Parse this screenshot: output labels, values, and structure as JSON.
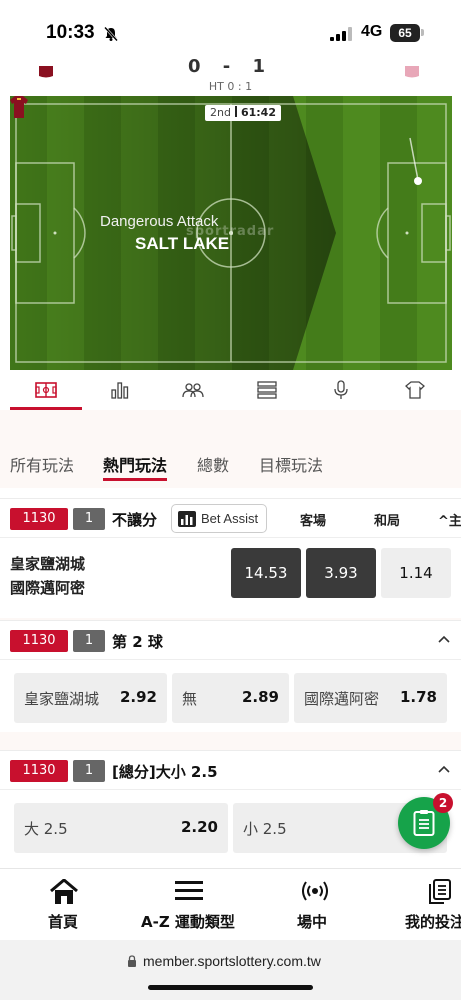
{
  "status_bar": {
    "time": "10:33",
    "network": "4G",
    "battery": "65"
  },
  "score_header": {
    "score": "0 - 1",
    "half_time": "HT 0 : 1"
  },
  "match_tracker": {
    "period": "2nd",
    "clock": "61:42",
    "event": "Dangerous Attack",
    "team": "SALT LAKE",
    "watermark": "sportradar"
  },
  "icon_tabs": [
    "pitch-icon",
    "stats-icon",
    "lineup-icon",
    "list-icon",
    "commentary-icon",
    "kit-icon"
  ],
  "category_tabs": [
    "所有玩法",
    "熱門玩法",
    "總數",
    "目標玩法"
  ],
  "active_category": "熱門玩法",
  "markets": {
    "m1": {
      "code": "1130",
      "num": "1",
      "title": "不讓分",
      "bet_assist": "Bet Assist",
      "headers": {
        "away": "客場",
        "draw": "和局",
        "home": "主"
      },
      "home_team": "皇家鹽湖城",
      "away_team": "國際邁阿密",
      "odds": {
        "away": "14.53",
        "draw": "3.93",
        "home": "1.14"
      }
    },
    "m2": {
      "code": "1130",
      "num": "1",
      "title": "第 2 球",
      "options": [
        {
          "label": "皇家鹽湖城",
          "odd": "2.92"
        },
        {
          "label": "無",
          "odd": "2.89"
        },
        {
          "label": "國際邁阿密",
          "odd": "1.78"
        }
      ]
    },
    "m3": {
      "code": "1130",
      "num": "1",
      "title": "[總分]大小 2.5",
      "options": [
        {
          "label": "大 2.5",
          "odd": "2.20"
        },
        {
          "label": "小 2.5",
          "odd": ""
        }
      ]
    }
  },
  "betslip": {
    "count": "2"
  },
  "bottom_nav": [
    "首頁",
    "A-Z 運動類型",
    "場中",
    "我的投注"
  ],
  "url": "member.sportslottery.com.tw",
  "colors": {
    "accent": "#c8102e",
    "fab": "#16a34a",
    "pitch": "#4f8a1e"
  }
}
